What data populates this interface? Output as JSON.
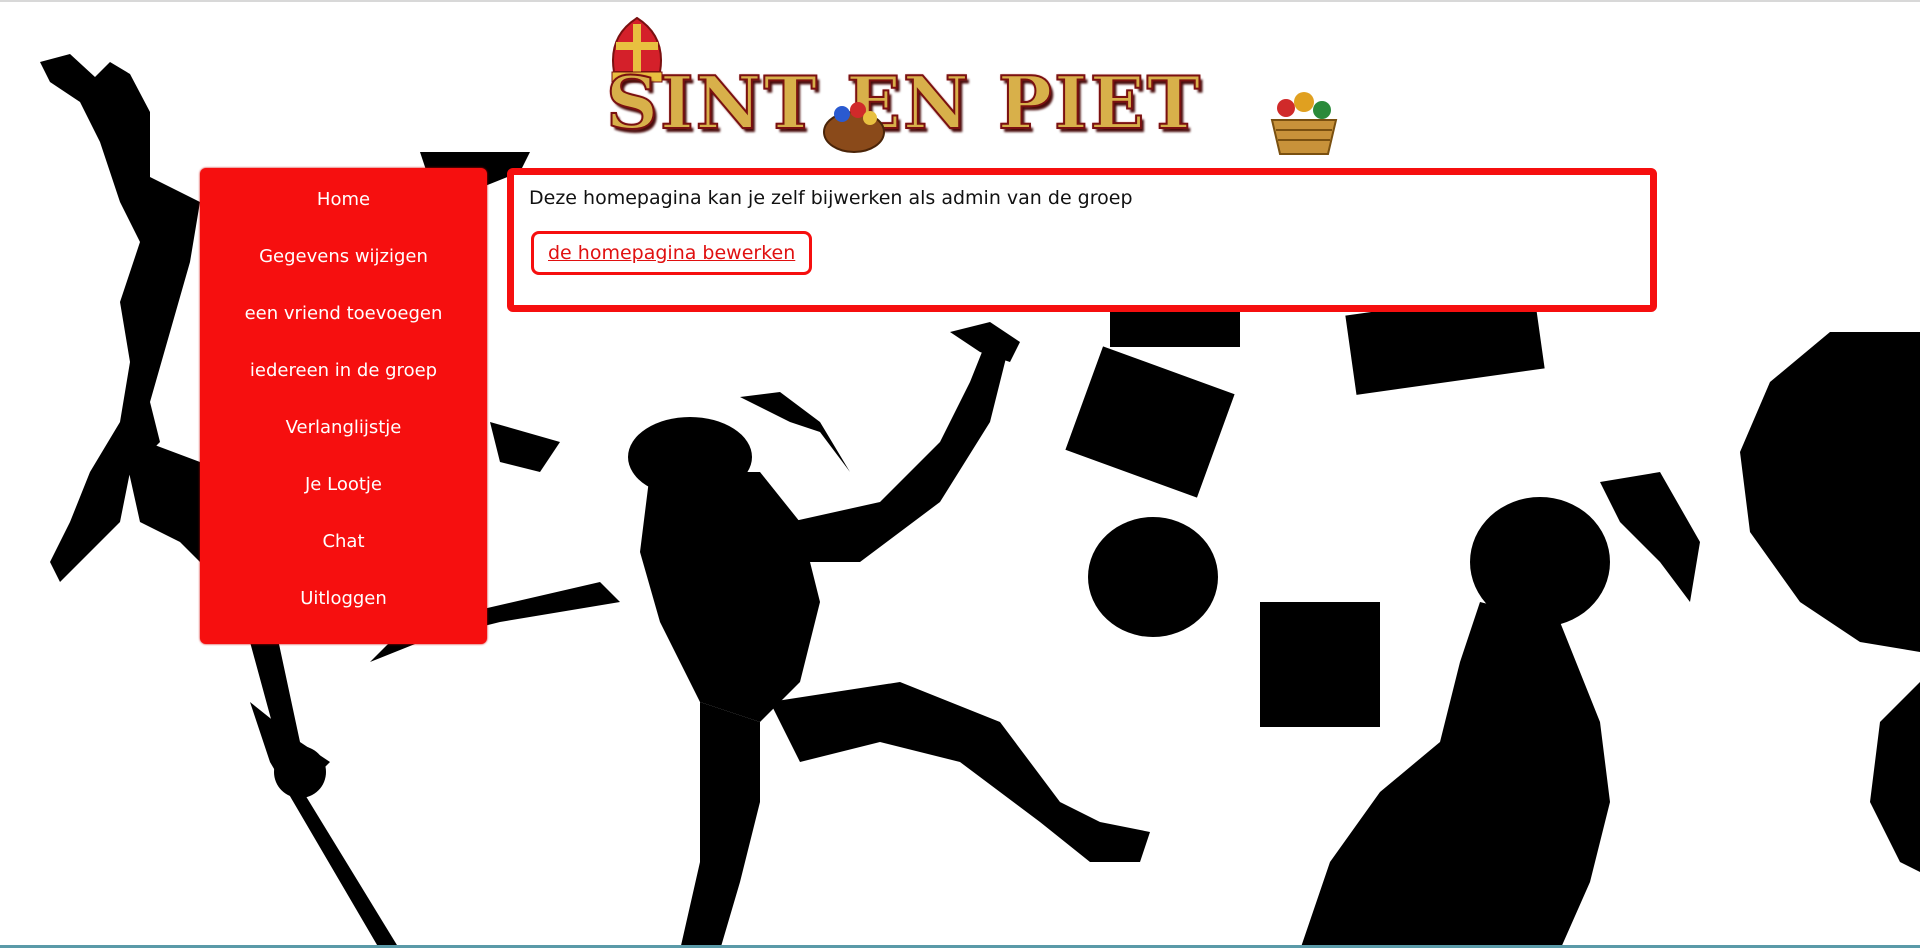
{
  "header": {
    "logo_text": "SINT EN PIET"
  },
  "sidebar": {
    "items": [
      {
        "label": "Home"
      },
      {
        "label": "Gegevens wijzigen"
      },
      {
        "label": "een vriend toevoegen"
      },
      {
        "label": "iedereen in de groep"
      },
      {
        "label": "Verlanglijstje"
      },
      {
        "label": "Je Lootje"
      },
      {
        "label": "Chat"
      },
      {
        "label": "Uitloggen"
      }
    ]
  },
  "main": {
    "intro_text": "Deze homepagina kan je zelf bijwerken als admin van de groep",
    "edit_button_label": "de homepagina bewerken"
  },
  "colors": {
    "accent_red": "#f60f0f",
    "silhouette": "#000000",
    "background": "#ffffff"
  }
}
